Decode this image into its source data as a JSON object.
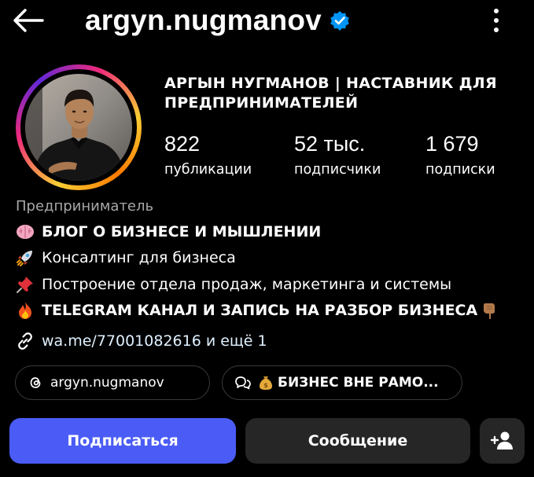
{
  "header": {
    "username": "argyn.nugmanov",
    "verified": true
  },
  "profile": {
    "full_name": "АРГЫН НУГМАНОВ | НАСТАВНИК ДЛЯ ПРЕДПРИНИМАТЕЛЕЙ",
    "stats": [
      {
        "value": "822",
        "label": "публикации"
      },
      {
        "value": "52 тыс.",
        "label": "подписчики"
      },
      {
        "value": "1 679",
        "label": "подписки"
      }
    ],
    "category": "Предприниматель",
    "bio": [
      {
        "icon": "brain-emoji",
        "text": "БЛОГ О БИЗНЕСЕ И МЫШЛЕНИИ"
      },
      {
        "icon": "rocket-emoji",
        "text": "Консалтинг для бизнеса"
      },
      {
        "icon": "pushpin-emoji",
        "text": "Построение отдела продаж, маркетинга и системы"
      },
      {
        "icon": "fire-emoji",
        "text": "TELEGRAM КАНАЛ И ЗАПИСЬ НА РАЗБОР БИЗНЕСА",
        "trailing_icon": "pointing-down-emoji"
      }
    ],
    "link": "wa.me/77001082616 и ещё 1"
  },
  "chips": {
    "threads": "argyn.nugmanov",
    "channel": "БИЗНЕС ВНЕ РАМО..."
  },
  "actions": {
    "follow": "Подписаться",
    "message": "Сообщение"
  },
  "colors": {
    "background": "#000000",
    "follow_button": "#4a5cf5",
    "secondary_button": "#262626",
    "verified_badge": "#0095f6",
    "muted_text": "#a8a8a8"
  }
}
